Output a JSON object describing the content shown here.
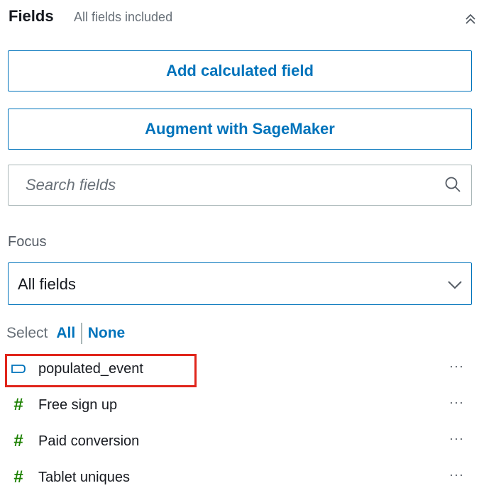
{
  "header": {
    "title": "Fields",
    "subtitle": "All fields included",
    "collapse_icon": "double-chevron-up-icon"
  },
  "buttons": {
    "add_calculated_field": "Add calculated field",
    "augment_sagemaker": "Augment with SageMaker"
  },
  "search": {
    "placeholder": "Search fields",
    "value": "",
    "icon": "search-icon"
  },
  "focus": {
    "label": "Focus",
    "selected": "All fields"
  },
  "selector": {
    "label": "Select",
    "all": "All",
    "none": "None"
  },
  "fields": [
    {
      "name": "populated_event",
      "type": "dimension",
      "icon": "dimension-tag-icon",
      "more": "···"
    },
    {
      "name": "Free sign up",
      "type": "measure",
      "icon": "hash-icon",
      "more": "···"
    },
    {
      "name": "Paid conversion",
      "type": "measure",
      "icon": "hash-icon",
      "more": "···"
    },
    {
      "name": "Tablet uniques",
      "type": "measure",
      "icon": "hash-icon",
      "more": "···"
    }
  ],
  "colors": {
    "accent": "#0073bb",
    "measure": "#1d8102",
    "highlight": "#e0251b"
  }
}
